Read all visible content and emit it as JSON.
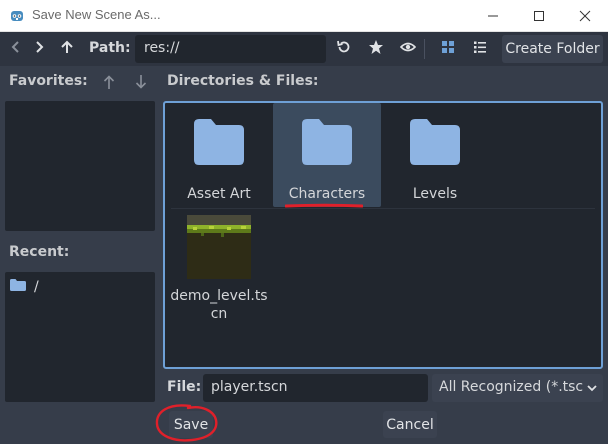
{
  "window": {
    "title": "Save New Scene As..."
  },
  "toolbar": {
    "path_label": "Path:",
    "path_value": "res://",
    "create_folder_label": "Create Folder"
  },
  "favorites": {
    "label": "Favorites:"
  },
  "recent": {
    "label": "Recent:",
    "items": [
      {
        "label": "/"
      }
    ]
  },
  "files": {
    "label": "Directories & Files:",
    "items": [
      {
        "name": "Asset Art",
        "type": "folder"
      },
      {
        "name": "Characters",
        "type": "folder",
        "selected": true
      },
      {
        "name": "Levels",
        "type": "folder"
      },
      {
        "name_line1": "demo_level.ts",
        "name_line2": "cn",
        "type": "scene"
      }
    ]
  },
  "file_row": {
    "label": "File:",
    "value": "player.tscn",
    "filter": "All Recognized (*.tscn"
  },
  "buttons": {
    "save": "Save",
    "cancel": "Cancel"
  },
  "colors": {
    "accent": "#6ea0d6",
    "folder": "#8eb4e3",
    "annotation_red": "#e0202a"
  },
  "icons": {
    "app": "godot-icon",
    "back": "chevron-left-icon",
    "forward": "chevron-right-icon",
    "up": "arrow-up-icon",
    "refresh": "refresh-icon",
    "favorite": "star-icon",
    "hidden": "eye-icon",
    "grid_view": "grid-view-icon",
    "list_view": "list-view-icon"
  }
}
